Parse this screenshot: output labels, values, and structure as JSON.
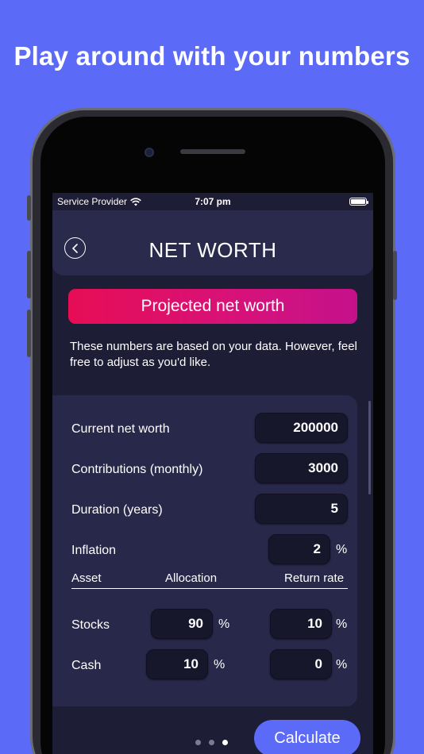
{
  "headline": "Play around with your numbers",
  "status": {
    "carrier": "Service Provider",
    "time": "7:07 pm"
  },
  "nav": {
    "title": "NET WORTH",
    "back_icon": "chevron-left-icon"
  },
  "banner": "Projected net worth",
  "intro": "These numbers are based on your data. However, feel free to adjust as you'd like.",
  "form": {
    "current_net_worth": {
      "label": "Current net worth",
      "value": "200000"
    },
    "contributions": {
      "label": "Contributions (monthly)",
      "value": "3000"
    },
    "duration": {
      "label": "Duration (years)",
      "value": "5"
    },
    "inflation": {
      "label": "Inflation",
      "value": "2",
      "unit": "%"
    }
  },
  "table": {
    "headers": {
      "asset": "Asset",
      "allocation": "Allocation",
      "return_rate": "Return rate"
    },
    "rows": [
      {
        "asset": "Stocks",
        "allocation": "90",
        "allocation_unit": "%",
        "return_rate": "10",
        "return_unit": "%"
      },
      {
        "asset": "Cash",
        "allocation": "10",
        "allocation_unit": "%",
        "return_rate": "0",
        "return_unit": "%"
      }
    ]
  },
  "pager": {
    "count": 3,
    "active_index": 2
  },
  "calculate_label": "Calculate",
  "colors": {
    "background": "#5b6af7",
    "screen": "#1e1d36",
    "banner_start": "#e60d55",
    "banner_end": "#c4118b",
    "accent": "#5b6af7"
  }
}
